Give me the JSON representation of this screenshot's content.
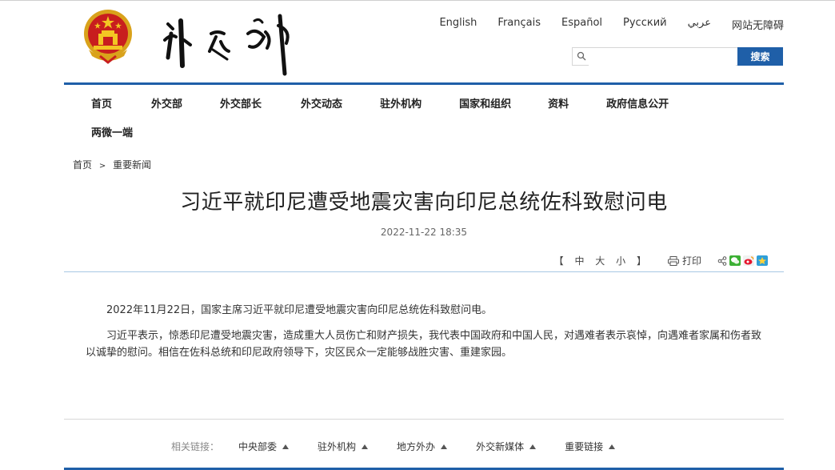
{
  "header": {
    "languages": [
      "English",
      "Français",
      "Español",
      "Русский",
      "عربي",
      "网站无障碍"
    ],
    "search": {
      "value": "",
      "button": "搜索"
    }
  },
  "nav": {
    "items": [
      "首页",
      "外交部",
      "外交部长",
      "外交动态",
      "驻外机构",
      "国家和组织",
      "资料",
      "政府信息公开"
    ],
    "second_row": "两微一端"
  },
  "breadcrumb": {
    "home": "首页",
    "separator": ">",
    "current": "重要新闻"
  },
  "article": {
    "title": "习近平就印尼遭受地震灾害向印尼总统佐科致慰问电",
    "date": "2022-11-22 18:35",
    "paragraphs": [
      "2022年11月22日，国家主席习近平就印尼遭受地震灾害向印尼总统佐科致慰问电。",
      "习近平表示，惊悉印尼遭受地震灾害，造成重大人员伤亡和财产损失，我代表中国政府和中国人民，对遇难者表示哀悼，向遇难者家属和伤者致以诚挚的慰问。相信在佐科总统和印尼政府领导下，灾区民众一定能够战胜灾害、重建家园。"
    ]
  },
  "tools": {
    "font_open": "【",
    "font_medium": "中",
    "font_large": "大",
    "font_small": "小",
    "font_close": "】",
    "print": "打印"
  },
  "footer": {
    "label": "相关链接：",
    "links": [
      "中央部委",
      "驻外机构",
      "地方外办",
      "外交新媒体",
      "重要链接"
    ]
  },
  "colors": {
    "brand_blue": "#1f5fa8"
  }
}
